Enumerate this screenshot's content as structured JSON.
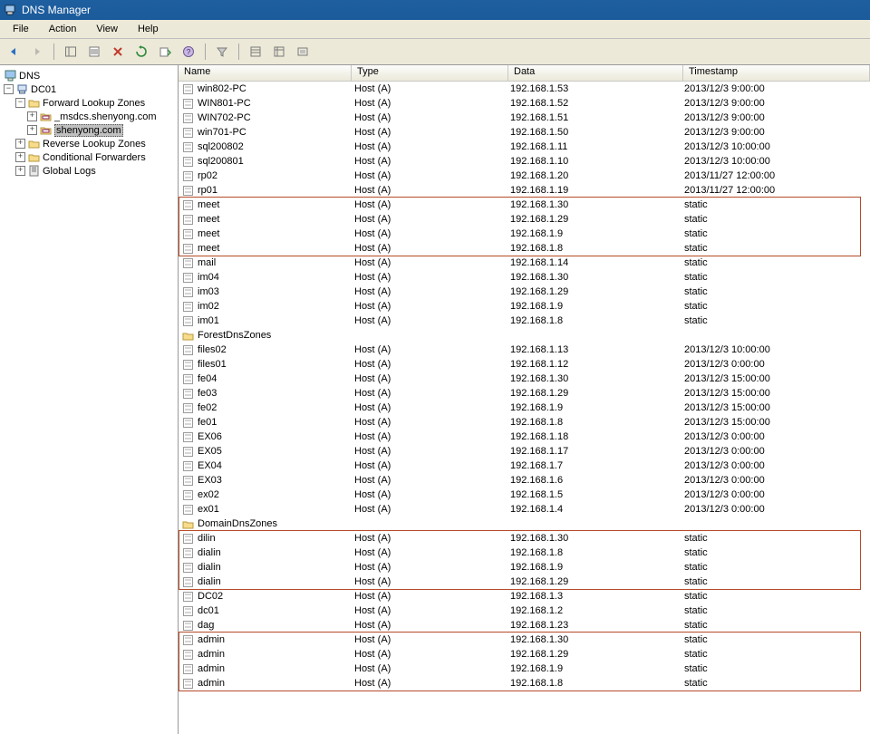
{
  "window": {
    "title": "DNS Manager"
  },
  "menu": [
    "File",
    "Action",
    "View",
    "Help"
  ],
  "tree": {
    "root": "DNS",
    "nodes": [
      {
        "label": "DC01",
        "expanded": true,
        "children": [
          {
            "label": "Forward Lookup Zones",
            "expanded": true,
            "children": [
              {
                "label": "_msdcs.shenyong.com"
              },
              {
                "label": "shenyong.com",
                "selected": true
              }
            ]
          },
          {
            "label": "Reverse Lookup Zones"
          },
          {
            "label": "Conditional Forwarders"
          },
          {
            "label": "Global Logs"
          }
        ]
      }
    ]
  },
  "columns": {
    "name": "Name",
    "type": "Type",
    "data": "Data",
    "ts": "Timestamp"
  },
  "records": [
    {
      "name": "win802-PC",
      "type": "Host (A)",
      "data": "192.168.1.53",
      "ts": "2013/12/3 9:00:00"
    },
    {
      "name": "WIN801-PC",
      "type": "Host (A)",
      "data": "192.168.1.52",
      "ts": "2013/12/3 9:00:00"
    },
    {
      "name": "WIN702-PC",
      "type": "Host (A)",
      "data": "192.168.1.51",
      "ts": "2013/12/3 9:00:00"
    },
    {
      "name": "win701-PC",
      "type": "Host (A)",
      "data": "192.168.1.50",
      "ts": "2013/12/3 9:00:00"
    },
    {
      "name": "sql200802",
      "type": "Host (A)",
      "data": "192.168.1.11",
      "ts": "2013/12/3 10:00:00"
    },
    {
      "name": "sql200801",
      "type": "Host (A)",
      "data": "192.168.1.10",
      "ts": "2013/12/3 10:00:00"
    },
    {
      "name": "rp02",
      "type": "Host (A)",
      "data": "192.168.1.20",
      "ts": "2013/11/27 12:00:00"
    },
    {
      "name": "rp01",
      "type": "Host (A)",
      "data": "192.168.1.19",
      "ts": "2013/11/27 12:00:00"
    },
    {
      "name": "meet",
      "type": "Host (A)",
      "data": "192.168.1.30",
      "ts": "static"
    },
    {
      "name": "meet",
      "type": "Host (A)",
      "data": "192.168.1.29",
      "ts": "static"
    },
    {
      "name": "meet",
      "type": "Host (A)",
      "data": "192.168.1.9",
      "ts": "static"
    },
    {
      "name": "meet",
      "type": "Host (A)",
      "data": "192.168.1.8",
      "ts": "static"
    },
    {
      "name": "mail",
      "type": "Host (A)",
      "data": "192.168.1.14",
      "ts": "static"
    },
    {
      "name": "im04",
      "type": "Host (A)",
      "data": "192.168.1.30",
      "ts": "static"
    },
    {
      "name": "im03",
      "type": "Host (A)",
      "data": "192.168.1.29",
      "ts": "static"
    },
    {
      "name": "im02",
      "type": "Host (A)",
      "data": "192.168.1.9",
      "ts": "static"
    },
    {
      "name": "im01",
      "type": "Host (A)",
      "data": "192.168.1.8",
      "ts": "static"
    },
    {
      "name": "ForestDnsZones",
      "type": "",
      "data": "",
      "ts": "",
      "folder": true
    },
    {
      "name": "files02",
      "type": "Host (A)",
      "data": "192.168.1.13",
      "ts": "2013/12/3 10:00:00"
    },
    {
      "name": "files01",
      "type": "Host (A)",
      "data": "192.168.1.12",
      "ts": "2013/12/3 0:00:00"
    },
    {
      "name": "fe04",
      "type": "Host (A)",
      "data": "192.168.1.30",
      "ts": "2013/12/3 15:00:00"
    },
    {
      "name": "fe03",
      "type": "Host (A)",
      "data": "192.168.1.29",
      "ts": "2013/12/3 15:00:00"
    },
    {
      "name": "fe02",
      "type": "Host (A)",
      "data": "192.168.1.9",
      "ts": "2013/12/3 15:00:00"
    },
    {
      "name": "fe01",
      "type": "Host (A)",
      "data": "192.168.1.8",
      "ts": "2013/12/3 15:00:00"
    },
    {
      "name": "EX06",
      "type": "Host (A)",
      "data": "192.168.1.18",
      "ts": "2013/12/3 0:00:00"
    },
    {
      "name": "EX05",
      "type": "Host (A)",
      "data": "192.168.1.17",
      "ts": "2013/12/3 0:00:00"
    },
    {
      "name": "EX04",
      "type": "Host (A)",
      "data": "192.168.1.7",
      "ts": "2013/12/3 0:00:00"
    },
    {
      "name": "EX03",
      "type": "Host (A)",
      "data": "192.168.1.6",
      "ts": "2013/12/3 0:00:00"
    },
    {
      "name": "ex02",
      "type": "Host (A)",
      "data": "192.168.1.5",
      "ts": "2013/12/3 0:00:00"
    },
    {
      "name": "ex01",
      "type": "Host (A)",
      "data": "192.168.1.4",
      "ts": "2013/12/3 0:00:00"
    },
    {
      "name": "DomainDnsZones",
      "type": "",
      "data": "",
      "ts": "",
      "folder": true
    },
    {
      "name": "dilin",
      "type": "Host (A)",
      "data": "192.168.1.30",
      "ts": "static"
    },
    {
      "name": "dialin",
      "type": "Host (A)",
      "data": "192.168.1.8",
      "ts": "static"
    },
    {
      "name": "dialin",
      "type": "Host (A)",
      "data": "192.168.1.9",
      "ts": "static"
    },
    {
      "name": "dialin",
      "type": "Host (A)",
      "data": "192.168.1.29",
      "ts": "static"
    },
    {
      "name": "DC02",
      "type": "Host (A)",
      "data": "192.168.1.3",
      "ts": "static"
    },
    {
      "name": "dc01",
      "type": "Host (A)",
      "data": "192.168.1.2",
      "ts": "static"
    },
    {
      "name": "dag",
      "type": "Host (A)",
      "data": "192.168.1.23",
      "ts": "static"
    },
    {
      "name": "admin",
      "type": "Host (A)",
      "data": "192.168.1.30",
      "ts": "static"
    },
    {
      "name": "admin",
      "type": "Host (A)",
      "data": "192.168.1.29",
      "ts": "static"
    },
    {
      "name": "admin",
      "type": "Host (A)",
      "data": "192.168.1.9",
      "ts": "static"
    },
    {
      "name": "admin",
      "type": "Host (A)",
      "data": "192.168.1.8",
      "ts": "static"
    }
  ],
  "highlights": [
    {
      "startIndex": 8,
      "count": 4
    },
    {
      "startIndex": 31,
      "count": 4
    },
    {
      "startIndex": 38,
      "count": 4
    }
  ]
}
